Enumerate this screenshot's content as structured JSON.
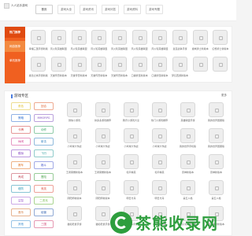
{
  "header": {
    "logo_text": "人人站手游网",
    "nav": [
      "首页",
      "游戏大全",
      "游戏资讯",
      "游戏问答",
      "游戏资料",
      "游戏专题"
    ]
  },
  "hot": {
    "side": [
      "热门推荐",
      "网游推荐",
      "单机推荐"
    ],
    "games": [
      "幸福三国手游新版",
      "风火轮英雄联盟",
      "风火轮英雄联盟",
      "风火轮英雄联盟",
      "风火轮英雄联盟",
      "风火轮英雄联盟",
      "风火轮英雄联盟",
      "皇室战争手游",
      "魔域勇士新版本",
      "幻想勇士新版本",
      "魔法之城手游新版",
      "",
      "",
      "",
      "",
      "",
      "",
      "",
      "",
      "",
      "",
      "",
      "",
      "",
      "",
      "",
      "",
      "",
      "",
      "",
      "魔法之城手游新版",
      "天堂传奇新版本",
      "天堂传奇新版本",
      "天堂传奇新版本",
      "天堂传奇新版本",
      "口袋妖怪新版本",
      "口袋妖怪新版本",
      "梦幻西游新版本",
      "",
      ""
    ]
  },
  "zone": {
    "title": "游戏专区",
    "more": "更多",
    "tags": [
      [
        "角色",
        "回合"
      ],
      [
        "策略",
        "MMORPG"
      ],
      [
        "卡牌",
        "动作"
      ],
      [
        "休闲",
        "射击"
      ],
      [
        "模拟",
        "飞行"
      ],
      [
        "赛车",
        "格斗"
      ],
      [
        "养成",
        "冒险"
      ],
      [
        "塔防",
        "竞技"
      ],
      [
        "益智",
        "二次元"
      ],
      [
        "音乐",
        "经营"
      ],
      [
        "其他",
        "三国"
      ]
    ],
    "games": [
      "微信小游戏",
      "拼多多游戏推荐",
      "腾讯小游戏大全",
      "热门小游戏推荐",
      "英雄联盟手游",
      "我的世界国服版",
      "小鸡球大作战",
      "小鸡球大作战",
      "小鸡球大作战",
      "小鸡球大作战",
      "我的世界手机版",
      "我的世界国服版",
      "王者荣耀新版本",
      "王者荣耀新版本",
      "和平精英",
      "和平精英",
      "原神新版本",
      "原神新版本",
      "阴阳师新版本",
      "阴阳师新版本",
      "明日方舟",
      "明日方舟",
      "第五人格",
      "第五人格",
      "猫和老鼠手游",
      "猫和老鼠手游",
      "QQ飞车手游",
      "QQ飞车手游",
      "蛋仔派对新版本",
      "蛋仔派对新版本"
    ]
  },
  "watermark": {
    "text": "茶熊收录网"
  },
  "colors": {
    "accent": "#f06020",
    "zone_bar": "#4a7de0",
    "watermark": "#2e9e3e"
  }
}
